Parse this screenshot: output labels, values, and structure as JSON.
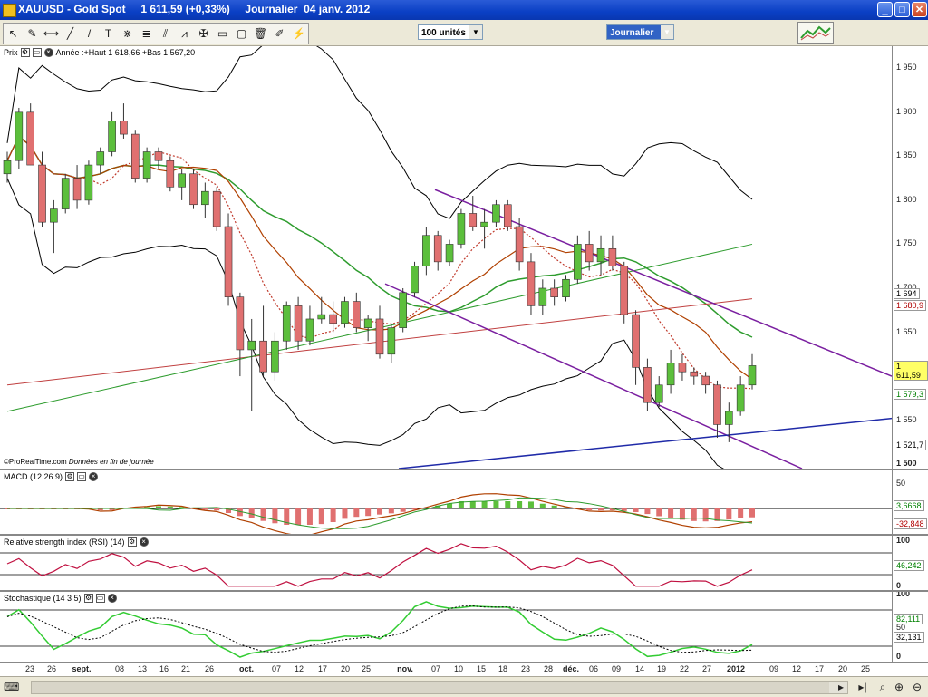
{
  "window": {
    "title": "XAUUSD - Gold Spot     1 611,59 (+0,33%)     Journalier  04 janv. 2012",
    "minimize": "_",
    "maximize": "□",
    "close": "✕"
  },
  "toolbar": {
    "tools": [
      "pointer-icon",
      "wrench-icon",
      "horizontal-line-icon",
      "trendline-icon",
      "line-icon",
      "text-icon",
      "fan-icon",
      "fibonacci-icon",
      "channel-icon",
      "zigzag-icon",
      "cross-icon",
      "rectangle-icon",
      "rectangle-alt-icon",
      "trash-icon",
      "pencil-icon",
      "magic-icon"
    ],
    "tool_glyphs": [
      "↖",
      "✎",
      "⟷",
      "╱",
      "/",
      "T",
      "⋇",
      "≣",
      "⫽",
      "⩘",
      "✠",
      "▭",
      "▢",
      "🗑",
      "✐",
      "⚡"
    ],
    "units_value": "100 unités",
    "period_value": "Journalier"
  },
  "price_panel": {
    "title": "Prix",
    "legend": "Année :+Haut 1 618,66 +Bas 1 567,20",
    "footer_brand": "©ProRealTime.com",
    "footer_note": "Données en fin de journée",
    "scale_labels": [
      "1 950",
      "1 900",
      "1 850",
      "1 800",
      "1 750",
      "1 700",
      "1 650",
      "1 600",
      "1 550",
      "1 500"
    ],
    "tags": [
      {
        "text": "1 694",
        "color": "#000000"
      },
      {
        "text": "1 680,9",
        "color": "#b00000"
      },
      {
        "text": "1 611,59",
        "color": "#000000",
        "bg": "#ffff66"
      },
      {
        "text": "1 579,3",
        "color": "#008000"
      },
      {
        "text": "1 521,7",
        "color": "#000000"
      }
    ]
  },
  "macd_panel": {
    "title": "MACD (12 26 9)",
    "scale_top": "50",
    "tags": [
      {
        "text": "3,6668",
        "color": "#008000"
      },
      {
        "text": "-32,848",
        "color": "#b00000"
      }
    ]
  },
  "rsi_panel": {
    "title": "Relative strength index (RSI) (14)",
    "scale_top": "100",
    "scale_bottom": "0",
    "tags": [
      {
        "text": "46,242",
        "color": "#008000"
      }
    ]
  },
  "stoch_panel": {
    "title": "Stochastique (14 3 5)",
    "scale_top": "100",
    "scale_mid": "50",
    "scale_bottom": "0",
    "tags": [
      {
        "text": "82,111",
        "color": "#008000"
      },
      {
        "text": "32,131",
        "color": "#000000"
      }
    ]
  },
  "x_axis": {
    "labels": [
      "23",
      "26",
      "sept.",
      "08",
      "13",
      "16",
      "21",
      "26",
      "oct.",
      "07",
      "12",
      "17",
      "20",
      "25",
      "nov.",
      "07",
      "10",
      "15",
      "18",
      "23",
      "28",
      "déc.",
      "06",
      "09",
      "14",
      "19",
      "22",
      "27",
      "2012",
      "09",
      "12",
      "17",
      "20",
      "25"
    ],
    "bold": [
      "sept.",
      "oct.",
      "nov.",
      "déc.",
      "2012"
    ]
  },
  "chart_data": {
    "type": "candlestick",
    "instrument": "XAUUSD - Gold Spot",
    "period": "daily",
    "last": 1611.59,
    "change_pct": 0.33,
    "ylim": [
      1495,
      1975
    ],
    "candles_ohlc": [
      [
        1830,
        1855,
        1820,
        1845
      ],
      [
        1845,
        1905,
        1835,
        1900
      ],
      [
        1900,
        1910,
        1840,
        1840
      ],
      [
        1840,
        1855,
        1770,
        1775
      ],
      [
        1775,
        1800,
        1740,
        1790
      ],
      [
        1790,
        1830,
        1785,
        1825
      ],
      [
        1825,
        1840,
        1790,
        1800
      ],
      [
        1800,
        1845,
        1795,
        1840
      ],
      [
        1840,
        1860,
        1830,
        1855
      ],
      [
        1855,
        1900,
        1850,
        1890
      ],
      [
        1890,
        1910,
        1870,
        1875
      ],
      [
        1875,
        1880,
        1820,
        1825
      ],
      [
        1825,
        1860,
        1820,
        1855
      ],
      [
        1855,
        1860,
        1835,
        1845
      ],
      [
        1845,
        1850,
        1810,
        1815
      ],
      [
        1815,
        1835,
        1800,
        1830
      ],
      [
        1830,
        1835,
        1790,
        1795
      ],
      [
        1795,
        1820,
        1780,
        1810
      ],
      [
        1810,
        1815,
        1765,
        1770
      ],
      [
        1770,
        1785,
        1680,
        1690
      ],
      [
        1690,
        1695,
        1600,
        1630
      ],
      [
        1630,
        1665,
        1560,
        1640
      ],
      [
        1640,
        1680,
        1600,
        1605
      ],
      [
        1605,
        1650,
        1595,
        1640
      ],
      [
        1640,
        1685,
        1630,
        1680
      ],
      [
        1680,
        1690,
        1630,
        1640
      ],
      [
        1640,
        1680,
        1635,
        1665
      ],
      [
        1665,
        1690,
        1660,
        1670
      ],
      [
        1670,
        1685,
        1650,
        1660
      ],
      [
        1660,
        1690,
        1655,
        1685
      ],
      [
        1685,
        1695,
        1650,
        1655
      ],
      [
        1655,
        1670,
        1640,
        1665
      ],
      [
        1665,
        1680,
        1620,
        1625
      ],
      [
        1625,
        1660,
        1615,
        1655
      ],
      [
        1655,
        1700,
        1650,
        1695
      ],
      [
        1695,
        1730,
        1690,
        1725
      ],
      [
        1725,
        1770,
        1715,
        1760
      ],
      [
        1760,
        1765,
        1720,
        1730
      ],
      [
        1730,
        1755,
        1725,
        1750
      ],
      [
        1750,
        1790,
        1745,
        1785
      ],
      [
        1785,
        1805,
        1765,
        1770
      ],
      [
        1770,
        1790,
        1745,
        1775
      ],
      [
        1775,
        1800,
        1770,
        1795
      ],
      [
        1795,
        1800,
        1765,
        1770
      ],
      [
        1770,
        1780,
        1720,
        1730
      ],
      [
        1730,
        1740,
        1670,
        1680
      ],
      [
        1680,
        1710,
        1670,
        1700
      ],
      [
        1700,
        1710,
        1680,
        1690
      ],
      [
        1690,
        1715,
        1685,
        1710
      ],
      [
        1710,
        1760,
        1705,
        1750
      ],
      [
        1750,
        1765,
        1720,
        1730
      ],
      [
        1730,
        1760,
        1715,
        1745
      ],
      [
        1745,
        1760,
        1720,
        1725
      ],
      [
        1725,
        1730,
        1660,
        1670
      ],
      [
        1670,
        1675,
        1590,
        1610
      ],
      [
        1610,
        1620,
        1560,
        1570
      ],
      [
        1570,
        1600,
        1565,
        1590
      ],
      [
        1590,
        1630,
        1580,
        1615
      ],
      [
        1615,
        1625,
        1595,
        1605
      ],
      [
        1605,
        1610,
        1590,
        1600
      ],
      [
        1600,
        1605,
        1580,
        1590
      ],
      [
        1590,
        1595,
        1530,
        1545
      ],
      [
        1545,
        1570,
        1525,
        1560
      ],
      [
        1560,
        1600,
        1555,
        1590
      ],
      [
        1590,
        1625,
        1585,
        1612
      ]
    ]
  },
  "colors": {
    "bull": "#5cbf3c",
    "bear": "#e07070",
    "bollinger": "#000000",
    "ma_fast": "#c0392b",
    "ma_mid": "#b04000",
    "ma_long_green": "#2e9c2e",
    "ma_long_red": "#c04040",
    "channel": "#7a1fa0",
    "support": "#1f2aa8"
  }
}
